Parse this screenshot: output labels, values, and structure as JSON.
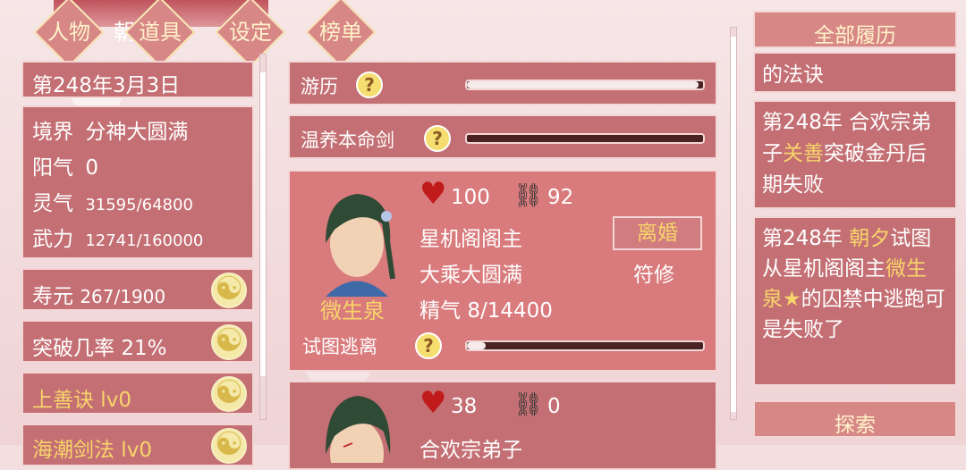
{
  "nav": {
    "tabs": [
      "人物",
      "道具",
      "设定",
      "榜单"
    ],
    "partial_name": "朝"
  },
  "status": {
    "date": "第248年3月3日",
    "realm_label": "境界",
    "realm_value": "分神大圆满",
    "yang_label": "阳气",
    "yang_value": "0",
    "spirit_label": "灵气",
    "spirit_value": "31595/64800",
    "power_label": "武力",
    "power_value": "12741/160000",
    "lifespan_label": "寿元",
    "lifespan_value": "267/1900",
    "breakthrough_label": "突破几率",
    "breakthrough_value": "21%",
    "skill1": "上善诀 lv0",
    "skill2": "海潮剑法 lv0"
  },
  "activities": [
    {
      "label": "游历",
      "progress": 0.98
    },
    {
      "label": "温养本命剑",
      "progress": 0.0
    }
  ],
  "cards": [
    {
      "name": "微生泉",
      "hearts": "100",
      "shackles": "92",
      "title": "星机阁阁主",
      "realm": "大乘大圆满",
      "essence_label": "精气",
      "essence_value": "8/14400",
      "divorce_button": "离婚",
      "role": "符修",
      "action_label": "试图逃离",
      "action_progress": 0.08
    },
    {
      "hearts": "38",
      "shackles": "0",
      "title": "合欢宗弟子"
    }
  ],
  "history": {
    "title": "全部履历",
    "partial_entry": "的法诀",
    "entries": [
      {
        "parts": [
          "第248年 合欢宗弟子",
          "关善",
          "突破金丹后期失败"
        ]
      },
      {
        "parts": [
          "第248年 ",
          "朝夕",
          "试图从星机阁阁主",
          "微生泉★",
          "的囚禁中逃跑可是失败了"
        ]
      }
    ],
    "explore_button": "探索"
  },
  "colors": {
    "panel": "#c46f73",
    "highlight": "#f7d56b",
    "heart": "#c01a1a"
  }
}
